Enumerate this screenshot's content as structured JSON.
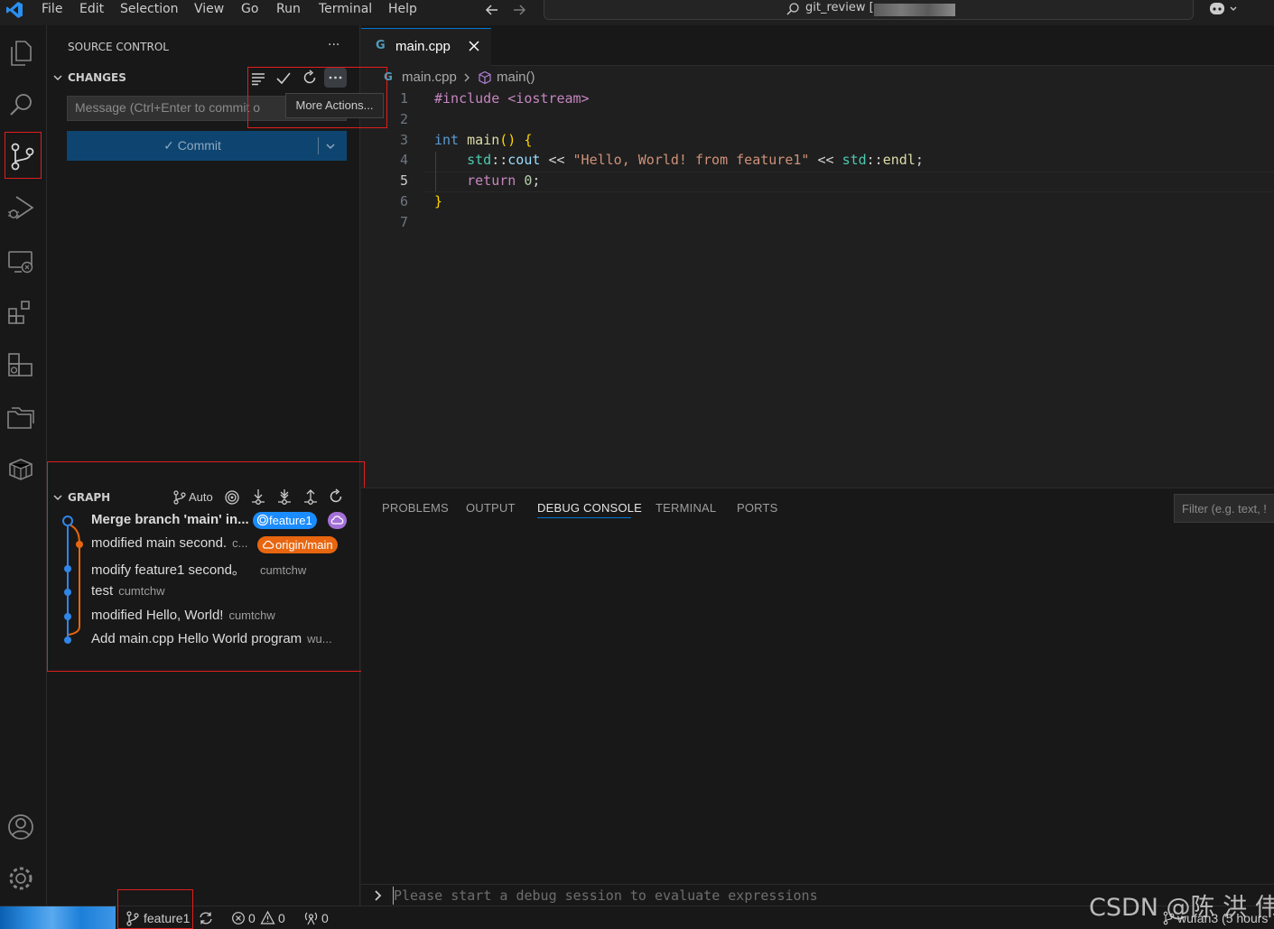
{
  "menu": [
    "File",
    "Edit",
    "Selection",
    "View",
    "Go",
    "Run",
    "Terminal",
    "Help"
  ],
  "command_center": {
    "text": "git_review ["
  },
  "sidebar": {
    "title": "SOURCE CONTROL",
    "more_label": "···",
    "changes_header": "CHANGES",
    "commit_placeholder": "Message (Ctrl+Enter to commit o",
    "commit_button": "✓ Commit",
    "tooltip": "More Actions...",
    "graph_header": "GRAPH",
    "graph_auto": "Auto",
    "graph": [
      {
        "message": "Merge branch 'main' in...",
        "author": "",
        "badge": "feature1"
      },
      {
        "message": "modified main second.",
        "author": "c...",
        "badge": "origin/main"
      },
      {
        "message": "modify feature1 second。",
        "author": "cumtchw",
        "badge": ""
      },
      {
        "message": "test",
        "author": "cumtchw",
        "badge": ""
      },
      {
        "message": "modified Hello, World!",
        "author": "cumtchw",
        "badge": ""
      },
      {
        "message": "Add main.cpp Hello World program",
        "author": "wu...",
        "badge": ""
      }
    ]
  },
  "editor": {
    "tab": "main.cpp",
    "breadcrumb_file": "main.cpp",
    "breadcrumb_symbol": "main()",
    "line_numbers": [
      "1",
      "2",
      "3",
      "4",
      "5",
      "6",
      "7"
    ],
    "code": {
      "l1": "#include <iostream>",
      "l3_kw": "int",
      "l3_fn": "main",
      "l4_ns": "std",
      "l4_var": "cout",
      "l4_str": "\"Hello, World! from feature1\"",
      "l4_ns2": "std",
      "l4_fn": "endl",
      "l5_kw": "return",
      "l5_num": "0"
    }
  },
  "panel": {
    "tabs": [
      "PROBLEMS",
      "OUTPUT",
      "DEBUG CONSOLE",
      "TERMINAL",
      "PORTS"
    ],
    "active_tab": "DEBUG CONSOLE",
    "filter_placeholder": "Filter (e.g. text, !",
    "debug_input_placeholder": "Please start a debug session to evaluate expressions"
  },
  "statusbar": {
    "branch": "feature1",
    "errors": "0",
    "warnings": "0",
    "ports": "0",
    "right_text": "wufan3 (5 hours"
  },
  "watermark": "CSDN @陈 洪 伟",
  "colors": {
    "accent": "#0078d4",
    "feature_badge": "#1b8cff",
    "origin_badge": "#e8660f",
    "cloud_badge": "#a470d8",
    "annotation_red": "#e01e1e"
  }
}
